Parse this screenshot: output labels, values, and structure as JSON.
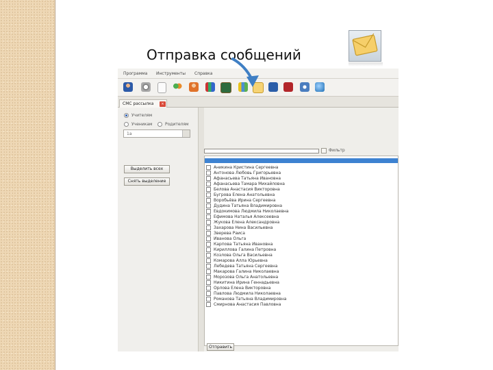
{
  "slide": {
    "title": "Отправка сообщений"
  },
  "app": {
    "menu": [
      "Программа",
      "Инструменты",
      "Справка"
    ],
    "toolbar_icons": [
      "user-icon",
      "clock-icon",
      "document-icon",
      "group-icon",
      "person-icon",
      "books-icon",
      "chalkboard-icon",
      "chart-icon",
      "envelope-icon",
      "book-blue-icon",
      "book-red-icon",
      "network-icon",
      "globe-icon"
    ],
    "tab": {
      "label": "СМС рассылка",
      "close": "×"
    },
    "left": {
      "radio_top": "Учителям",
      "radio_a": "Ученикам",
      "radio_b": "Родителям",
      "combo_value": "1а",
      "btn_1": "Выделить всех",
      "btn_2": "Снять выделение"
    },
    "right": {
      "filter_label": "Фильтр",
      "send_label": "Отправить",
      "rows": [
        "Аникина Кристина Сергеевна",
        "Антонова Любовь Григорьевна",
        "Афанасьева Татьяна Ивановна",
        "Афанасьева Тамара Михайловна",
        "Белова Анастасия Викторовна",
        "Бугрова Елена Анатольевна",
        "Воробьёва Ирина Сергеевна",
        "Дудина Татьяна Владимировна",
        "Евдокимова Людмила Николаевна",
        "Ефимова Наталья Алексеевна",
        "Жукова Елена Александровна",
        "Захарова Нина Васильевна",
        "Зверева Раиса",
        "Иванова Ольга",
        "Карпова Татьяна Ивановна",
        "Кириллова Галина Петровна",
        "Козлова Ольга Васильевна",
        "Комарова Алла Юрьевна",
        "Лебедева Татьяна Сергеевна",
        "Макарова Галина Николаевна",
        "Морозова Ольга Анатольевна",
        "Никитина Ирина Геннадьевна",
        "Орлова Елена Викторовна",
        "Павлова Людмила Николаевна",
        "Романова Татьяна Владимировна",
        "Смирнова Анастасия Павловна"
      ]
    }
  },
  "colors": {
    "accent": "#3d82d1",
    "arrow": "#3f7fc4",
    "tab_close": "#d94a3a",
    "band": "#eed7b4"
  }
}
